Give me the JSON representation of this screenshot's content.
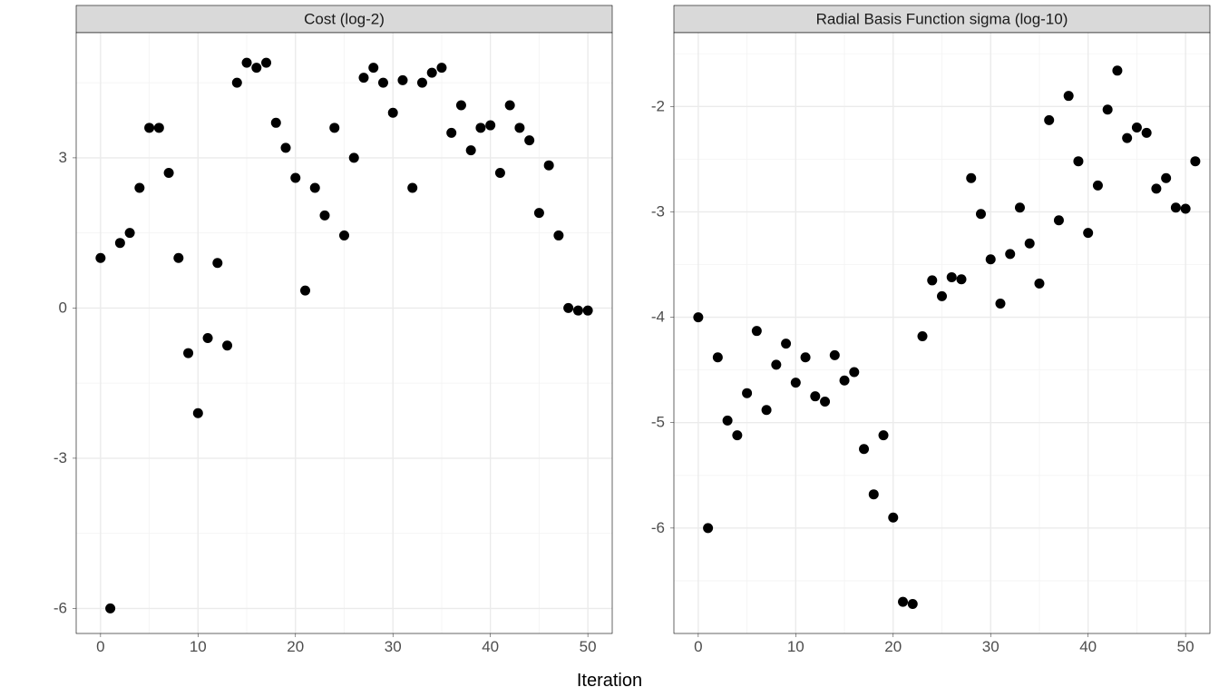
{
  "xlabel": "Iteration",
  "facets": [
    {
      "title": "Cost (log-2)",
      "x_range": [
        -2.5,
        52.5
      ],
      "y_range": [
        -6.5,
        5.5
      ],
      "x_ticks": [
        0,
        10,
        20,
        30,
        40,
        50
      ],
      "y_ticks": [
        -6,
        -3,
        0,
        3
      ],
      "points": [
        {
          "x": 0,
          "y": 1.0
        },
        {
          "x": 1,
          "y": -6.0
        },
        {
          "x": 2,
          "y": 1.3
        },
        {
          "x": 3,
          "y": 1.5
        },
        {
          "x": 4,
          "y": 2.4
        },
        {
          "x": 5,
          "y": 3.6
        },
        {
          "x": 6,
          "y": 3.6
        },
        {
          "x": 7,
          "y": 2.7
        },
        {
          "x": 8,
          "y": 1.0
        },
        {
          "x": 9,
          "y": -0.9
        },
        {
          "x": 10,
          "y": -2.1
        },
        {
          "x": 11,
          "y": -0.6
        },
        {
          "x": 12,
          "y": 0.9
        },
        {
          "x": 13,
          "y": -0.75
        },
        {
          "x": 14,
          "y": 4.5
        },
        {
          "x": 15,
          "y": 4.9
        },
        {
          "x": 16,
          "y": 4.8
        },
        {
          "x": 17,
          "y": 4.9
        },
        {
          "x": 18,
          "y": 3.7
        },
        {
          "x": 19,
          "y": 3.2
        },
        {
          "x": 20,
          "y": 2.6
        },
        {
          "x": 21,
          "y": 0.35
        },
        {
          "x": 22,
          "y": 2.4
        },
        {
          "x": 23,
          "y": 1.85
        },
        {
          "x": 24,
          "y": 3.6
        },
        {
          "x": 25,
          "y": 1.45
        },
        {
          "x": 26,
          "y": 3.0
        },
        {
          "x": 27,
          "y": 4.6
        },
        {
          "x": 28,
          "y": 4.8
        },
        {
          "x": 29,
          "y": 4.5
        },
        {
          "x": 30,
          "y": 3.9
        },
        {
          "x": 31,
          "y": 4.55
        },
        {
          "x": 32,
          "y": 2.4
        },
        {
          "x": 33,
          "y": 4.5
        },
        {
          "x": 34,
          "y": 4.7
        },
        {
          "x": 35,
          "y": 4.8
        },
        {
          "x": 36,
          "y": 3.5
        },
        {
          "x": 37,
          "y": 4.05
        },
        {
          "x": 38,
          "y": 3.15
        },
        {
          "x": 39,
          "y": 3.6
        },
        {
          "x": 40,
          "y": 3.65
        },
        {
          "x": 41,
          "y": 2.7
        },
        {
          "x": 42,
          "y": 4.05
        },
        {
          "x": 43,
          "y": 3.6
        },
        {
          "x": 44,
          "y": 3.35
        },
        {
          "x": 45,
          "y": 1.9
        },
        {
          "x": 46,
          "y": 2.85
        },
        {
          "x": 47,
          "y": 1.45
        },
        {
          "x": 48,
          "y": 0.0
        },
        {
          "x": 49,
          "y": -0.05
        },
        {
          "x": 50,
          "y": -0.05
        }
      ]
    },
    {
      "title": "Radial Basis Function sigma (log-10)",
      "x_range": [
        -2.5,
        52.5
      ],
      "y_range": [
        -7.0,
        -1.3
      ],
      "x_ticks": [
        0,
        10,
        20,
        30,
        40,
        50
      ],
      "y_ticks": [
        -6,
        -5,
        -4,
        -3,
        -2
      ],
      "points": [
        {
          "x": 0,
          "y": -4.0
        },
        {
          "x": 1,
          "y": -6.0
        },
        {
          "x": 2,
          "y": -4.38
        },
        {
          "x": 3,
          "y": -4.98
        },
        {
          "x": 4,
          "y": -5.12
        },
        {
          "x": 5,
          "y": -4.72
        },
        {
          "x": 6,
          "y": -4.13
        },
        {
          "x": 7,
          "y": -4.88
        },
        {
          "x": 8,
          "y": -4.45
        },
        {
          "x": 9,
          "y": -4.25
        },
        {
          "x": 10,
          "y": -4.62
        },
        {
          "x": 11,
          "y": -4.38
        },
        {
          "x": 12,
          "y": -4.75
        },
        {
          "x": 13,
          "y": -4.8
        },
        {
          "x": 14,
          "y": -4.36
        },
        {
          "x": 15,
          "y": -4.6
        },
        {
          "x": 16,
          "y": -4.52
        },
        {
          "x": 17,
          "y": -5.25
        },
        {
          "x": 18,
          "y": -5.68
        },
        {
          "x": 19,
          "y": -5.12
        },
        {
          "x": 20,
          "y": -5.9
        },
        {
          "x": 21,
          "y": -6.7
        },
        {
          "x": 22,
          "y": -6.72
        },
        {
          "x": 23,
          "y": -4.18
        },
        {
          "x": 24,
          "y": -3.65
        },
        {
          "x": 25,
          "y": -3.8
        },
        {
          "x": 26,
          "y": -3.62
        },
        {
          "x": 27,
          "y": -3.64
        },
        {
          "x": 28,
          "y": -2.68
        },
        {
          "x": 29,
          "y": -3.02
        },
        {
          "x": 30,
          "y": -3.45
        },
        {
          "x": 31,
          "y": -3.87
        },
        {
          "x": 32,
          "y": -3.4
        },
        {
          "x": 33,
          "y": -2.96
        },
        {
          "x": 34,
          "y": -3.3
        },
        {
          "x": 35,
          "y": -3.68
        },
        {
          "x": 36,
          "y": -2.13
        },
        {
          "x": 37,
          "y": -3.08
        },
        {
          "x": 38,
          "y": -1.9
        },
        {
          "x": 39,
          "y": -2.52
        },
        {
          "x": 40,
          "y": -3.2
        },
        {
          "x": 41,
          "y": -2.75
        },
        {
          "x": 42,
          "y": -2.03
        },
        {
          "x": 43,
          "y": -1.66
        },
        {
          "x": 44,
          "y": -2.3
        },
        {
          "x": 45,
          "y": -2.2
        },
        {
          "x": 46,
          "y": -2.25
        },
        {
          "x": 47,
          "y": -2.78
        },
        {
          "x": 48,
          "y": -2.68
        },
        {
          "x": 49,
          "y": -2.96
        },
        {
          "x": 50,
          "y": -2.97
        },
        {
          "x": 51,
          "y": -2.52
        }
      ]
    }
  ],
  "chart_data": [
    {
      "type": "scatter",
      "title": "Cost (log-2)",
      "xlabel": "Iteration",
      "ylabel": "",
      "xlim": [
        -2.5,
        52.5
      ],
      "ylim": [
        -6.5,
        5.5
      ],
      "x": [
        0,
        1,
        2,
        3,
        4,
        5,
        6,
        7,
        8,
        9,
        10,
        11,
        12,
        13,
        14,
        15,
        16,
        17,
        18,
        19,
        20,
        21,
        22,
        23,
        24,
        25,
        26,
        27,
        28,
        29,
        30,
        31,
        32,
        33,
        34,
        35,
        36,
        37,
        38,
        39,
        40,
        41,
        42,
        43,
        44,
        45,
        46,
        47,
        48,
        49,
        50
      ],
      "y": [
        1.0,
        -6.0,
        1.3,
        1.5,
        2.4,
        3.6,
        3.6,
        2.7,
        1.0,
        -0.9,
        -2.1,
        -0.6,
        0.9,
        -0.75,
        4.5,
        4.9,
        4.8,
        4.9,
        3.7,
        3.2,
        2.6,
        0.35,
        2.4,
        1.85,
        3.6,
        1.45,
        3.0,
        4.6,
        4.8,
        4.5,
        3.9,
        4.55,
        2.4,
        4.5,
        4.7,
        4.8,
        3.5,
        4.05,
        3.15,
        3.6,
        3.65,
        2.7,
        4.05,
        3.6,
        3.35,
        1.9,
        2.85,
        1.45,
        0.0,
        -0.05,
        -0.05
      ]
    },
    {
      "type": "scatter",
      "title": "Radial Basis Function sigma (log-10)",
      "xlabel": "Iteration",
      "ylabel": "",
      "xlim": [
        -2.5,
        52.5
      ],
      "ylim": [
        -7.0,
        -1.3
      ],
      "x": [
        0,
        1,
        2,
        3,
        4,
        5,
        6,
        7,
        8,
        9,
        10,
        11,
        12,
        13,
        14,
        15,
        16,
        17,
        18,
        19,
        20,
        21,
        22,
        23,
        24,
        25,
        26,
        27,
        28,
        29,
        30,
        31,
        32,
        33,
        34,
        35,
        36,
        37,
        38,
        39,
        40,
        41,
        42,
        43,
        44,
        45,
        46,
        47,
        48,
        49,
        50,
        51
      ],
      "y": [
        -4.0,
        -6.0,
        -4.38,
        -4.98,
        -5.12,
        -4.72,
        -4.13,
        -4.88,
        -4.45,
        -4.25,
        -4.62,
        -4.38,
        -4.75,
        -4.8,
        -4.36,
        -4.6,
        -4.52,
        -5.25,
        -5.68,
        -5.12,
        -5.9,
        -6.7,
        -6.72,
        -4.18,
        -3.65,
        -3.8,
        -3.62,
        -3.64,
        -2.68,
        -3.02,
        -3.45,
        -3.87,
        -3.4,
        -2.96,
        -3.3,
        -3.68,
        -2.13,
        -3.08,
        -1.9,
        -2.52,
        -3.2,
        -2.75,
        -2.03,
        -1.66,
        -2.3,
        -2.2,
        -2.25,
        -2.78,
        -2.68,
        -2.96,
        -2.97,
        -2.52
      ]
    }
  ]
}
